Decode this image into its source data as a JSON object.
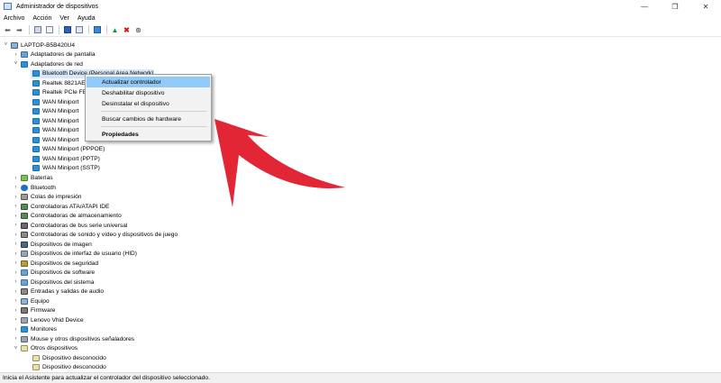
{
  "window": {
    "title": "Administrador de dispositivos",
    "min": "—",
    "max": "❐",
    "close": "✕"
  },
  "menu": [
    "Archivo",
    "Acción",
    "Ver",
    "Ayuda"
  ],
  "toolbar_icons": [
    "back-arrow-icon",
    "forward-arrow-icon",
    "properties-icon",
    "list-view-icon",
    "help-icon",
    "device-list-icon",
    "monitor-icon",
    "update-driver-icon",
    "uninstall-icon",
    "download-icon"
  ],
  "tree": {
    "root": "LAPTOP-B5B420U4",
    "display_adapters": "Adaptadores de pantalla",
    "network_adapters": "Adaptadores de red",
    "network_children": [
      "Bluetooth Device (Personal Area Network)",
      "Realtek 8821AE",
      "Realtek PCIe FE",
      "WAN Miniport",
      "WAN Miniport",
      "WAN Miniport",
      "WAN Miniport",
      "WAN Miniport",
      "WAN Miniport (PPPOE)",
      "WAN Miniport (PPTP)",
      "WAN Miniport (SSTP)"
    ],
    "categories": [
      "Baterías",
      "Bluetooth",
      "Colas de impresión",
      "Controladoras ATA/ATAPI IDE",
      "Controladoras de almacenamiento",
      "Controladoras de bus serie universal",
      "Controladoras de sonido y vídeo y dispositivos de juego",
      "Dispositivos de imagen",
      "Dispositivos de interfaz de usuario (HID)",
      "Dispositivos de seguridad",
      "Dispositivos de software",
      "Dispositivos del sistema",
      "Entradas y salidas de audio",
      "Equipo",
      "Firmware",
      "Lenovo Vhid Device",
      "Monitores",
      "Mouse y otros dispositivos señaladores"
    ],
    "other_devices": "Otros dispositivos",
    "other_children": [
      "Dispositivo desconocido",
      "Dispositivo desconocido"
    ]
  },
  "context_menu": {
    "update": "Actualizar controlador",
    "disable": "Deshabilitar dispositivo",
    "uninstall": "Desinstalar el dispositivo",
    "scan": "Buscar cambios de hardware",
    "properties": "Propiedades"
  },
  "status": "Inicia el Asistente para actualizar el controlador del dispositivo seleccionado.",
  "colors": {
    "accent": "#e32636",
    "highlight": "#91c9f7",
    "selection": "#d6e7fa"
  }
}
